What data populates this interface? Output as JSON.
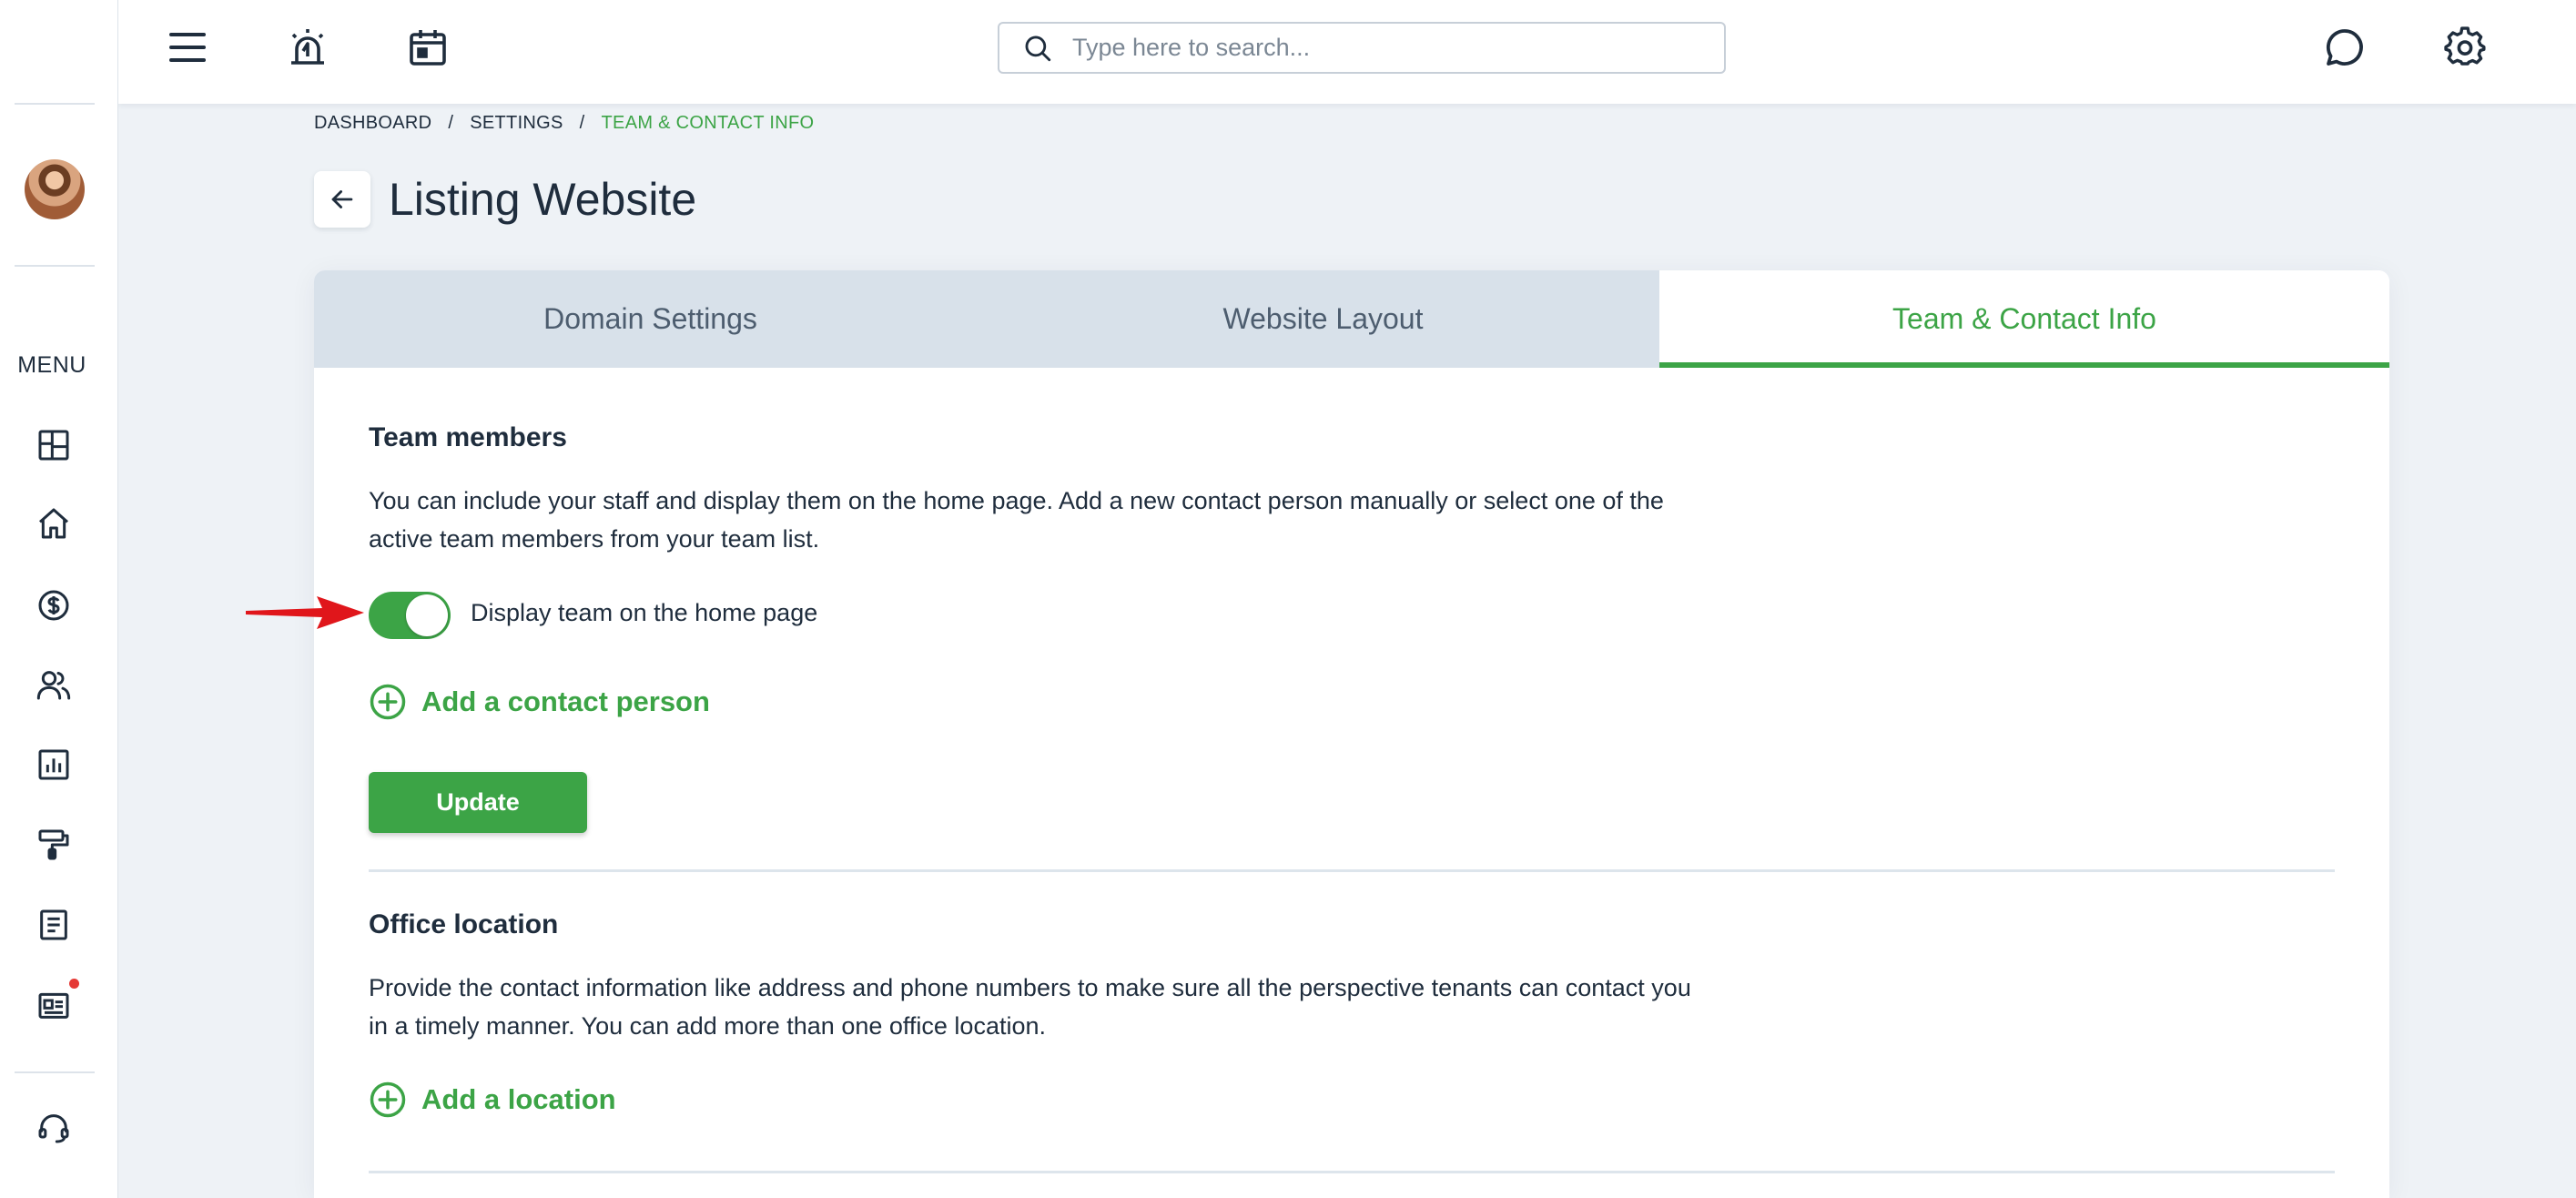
{
  "sidebar": {
    "menu_label": "MENU",
    "items": [
      {
        "name": "dashboard"
      },
      {
        "name": "home"
      },
      {
        "name": "finance"
      },
      {
        "name": "contacts"
      },
      {
        "name": "reports"
      },
      {
        "name": "maintenance"
      },
      {
        "name": "documents"
      },
      {
        "name": "listings",
        "badge": true
      }
    ]
  },
  "topbar": {
    "search_placeholder": "Type here to search..."
  },
  "breadcrumb": {
    "items": [
      "DASHBOARD",
      "SETTINGS",
      "TEAM & CONTACT INFO"
    ],
    "separator": "/"
  },
  "page": {
    "title": "Listing Website"
  },
  "tabs": [
    {
      "label": "Domain Settings",
      "active": false
    },
    {
      "label": "Website Layout",
      "active": false
    },
    {
      "label": "Team & Contact Info",
      "active": true
    }
  ],
  "team_section": {
    "title": "Team members",
    "description": "You can include your staff and display them on the home page. Add a new contact person manually or select one of the active team members from your team list.",
    "toggle_label": "Display team on the home page",
    "toggle_on": true,
    "add_link": "Add a contact person",
    "update_button": "Update"
  },
  "office_section": {
    "title": "Office location",
    "description": "Provide the contact information like address and phone numbers to make sure all the perspective tenants can contact you in a timely manner. You can add more than one office location.",
    "add_link": "Add a location"
  },
  "colors": {
    "accent": "#3ca446",
    "text": "#1f2d3d",
    "tab_inactive_bg": "#d8e1ea",
    "page_bg": "#eef2f6",
    "annotation_arrow": "#e0161b"
  }
}
